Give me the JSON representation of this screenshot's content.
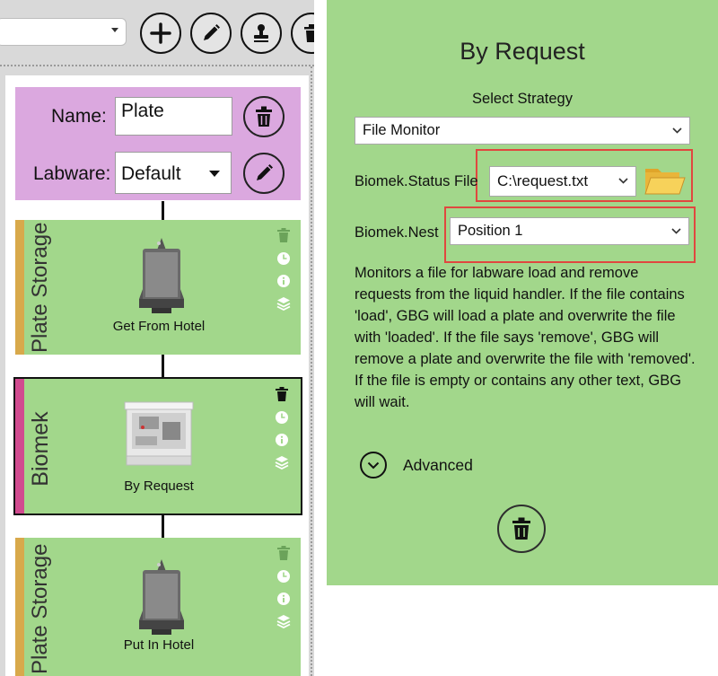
{
  "left": {
    "toolbar": {
      "buttons": [
        {
          "name": "add",
          "icon": "plus-icon"
        },
        {
          "name": "edit",
          "icon": "pencil-icon"
        },
        {
          "name": "stamp",
          "icon": "stamp-icon"
        },
        {
          "name": "delete",
          "icon": "trash-icon"
        }
      ]
    },
    "plate": {
      "name_label": "Name:",
      "name_value": "Plate",
      "labware_label": "Labware:",
      "labware_value": "Default"
    },
    "steps": [
      {
        "group": "Plate Storage",
        "name": "Get From Hotel",
        "stripe_color": "#d8a94b",
        "device_icon": "hotel-device-icon",
        "selected": false
      },
      {
        "group": "Biomek",
        "name": "By Request",
        "stripe_color": "#d14b8f",
        "device_icon": "biomek-device-icon",
        "selected": true
      },
      {
        "group": "Plate Storage",
        "name": "Put In Hotel",
        "stripe_color": "#d8a94b",
        "device_icon": "hotel-device-icon",
        "selected": false
      }
    ]
  },
  "right": {
    "title": "By Request",
    "select_strategy_label": "Select Strategy",
    "strategy_value": "File Monitor",
    "status_file_label": "Biomek.Status File",
    "status_file_value": "C:\\request.txt",
    "nest_label": "Biomek.Nest",
    "nest_value": "Position 1",
    "description": "Monitors a file for labware load and remove requests from the liquid handler. If the file contains 'load', GBG will load a plate and overwrite the file with 'loaded'.  If the file says 'remove', GBG will remove a plate and overwrite the file with 'removed'.  If the file is empty or contains any other text, GBG will wait.",
    "advanced_label": "Advanced",
    "colors": {
      "panel": "#a2d78b",
      "highlight": "#e0473f",
      "plate_card": "#dba8df"
    }
  }
}
